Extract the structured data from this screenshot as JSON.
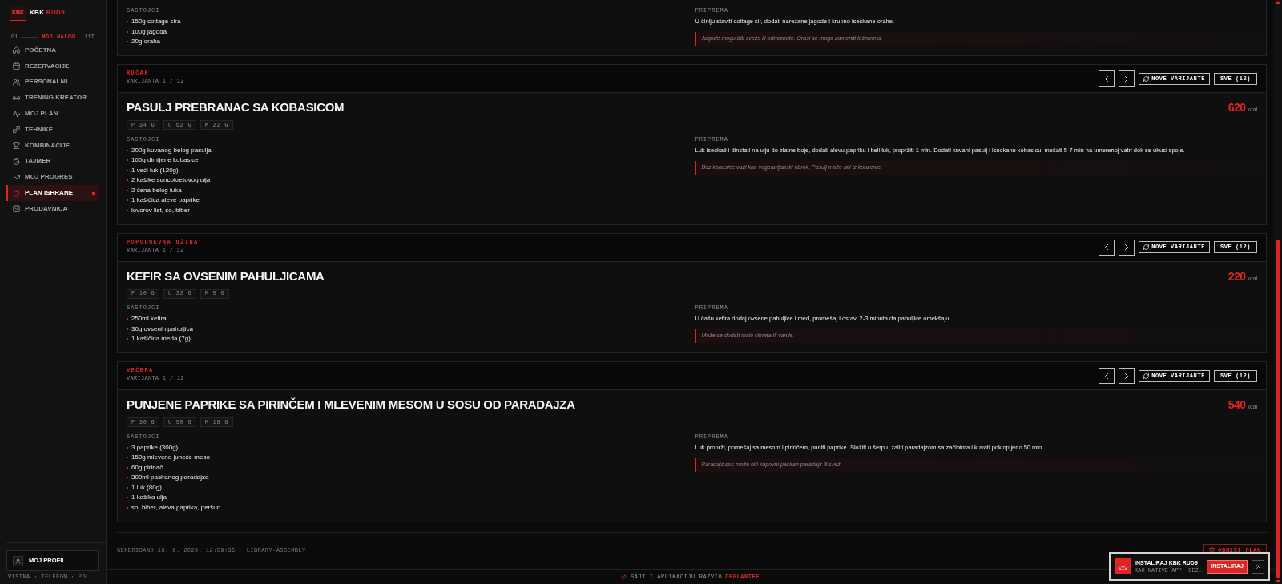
{
  "sidebar": {
    "logo": {
      "mark": "KBK",
      "title": "KBK",
      "accent": "RUD9"
    },
    "section": {
      "index": "01",
      "title": "MOJ NALOG",
      "count": "11T"
    },
    "items": [
      {
        "label": "POČETNA",
        "selected": false
      },
      {
        "label": "REZERVACIJE",
        "selected": false
      },
      {
        "label": "PERSONALNI",
        "selected": false
      },
      {
        "label": "TRENING KREATOR",
        "selected": false
      },
      {
        "label": "MOJ PLAN",
        "selected": false
      },
      {
        "label": "TEHNIKE",
        "selected": false
      },
      {
        "label": "KOMBINACIJE",
        "selected": false
      },
      {
        "label": "TAJMER",
        "selected": false
      },
      {
        "label": "MOJ PROGRES",
        "selected": false
      },
      {
        "label": "PLAN ISHRANE",
        "selected": true
      },
      {
        "label": "PRODAVNICA",
        "selected": false
      }
    ],
    "profile": {
      "label": "MOJ PROFIL",
      "hint": "VISINA · TELEFON · POL"
    }
  },
  "meals": [
    {
      "ingredients_label": "SASTOJCI",
      "ingredients": [
        "150g cottage sira",
        "100g jagoda",
        "20g oraha"
      ],
      "prep_label": "PRIPREMA",
      "prep": "U činiju staviti cottage sir, dodati narezane jagode i krupno iseckane orahe.",
      "note": "Jagode mogu biti sveže ili odmrznute. Orasi se mogu zameniti lešnicima."
    },
    {
      "type": "RUČAK",
      "variant": "VARIJANTA 1 / 12",
      "buttons": {
        "refresh": "NOVE VARIJANTE",
        "all": "SVE (12)"
      },
      "title": "PASULJ PREBRANAC SA KOBASICOM",
      "kcal": "620",
      "kcal_unit": "kcal",
      "macros": [
        "P 34 G",
        "U 62 G",
        "M 22 G"
      ],
      "ingredients_label": "SASTOJCI",
      "ingredients": [
        "200g kuvanog belog pasulja",
        "100g dimljene kobasice",
        "1 veći luk (120g)",
        "2 kašike suncokretovog ulja",
        "2 čena belog luka",
        "1 kašičica aleve paprike",
        "lovorov list, so, biber"
      ],
      "prep_label": "PRIPREMA",
      "prep": "Luk iseckati i dinstati na ulju do zlatne boje, dodati alevu papriku i beli luk, propržiti 1 min. Dodati kuvani pasulj i iseckanu kobasicu, mešati 5-7 min na umerenoj vatri dok se ukusi spoje.",
      "note": "Bez kobasice važi kao vegetarijanski obrok. Pasulj može biti iz konzerve."
    },
    {
      "type": "POPODNEVNA UŽINA",
      "variant": "VARIJANTA 1 / 12",
      "buttons": {
        "refresh": "NOVE VARIJANTE",
        "all": "SVE (12)"
      },
      "title": "KEFIR SA OVSENIM PAHULJICAMA",
      "kcal": "220",
      "kcal_unit": "kcal",
      "macros": [
        "P 10 G",
        "U 32 G",
        "M 5 G"
      ],
      "ingredients_label": "SASTOJCI",
      "ingredients": [
        "250ml kefira",
        "30g ovsenih pahuljica",
        "1 kašičica meda (7g)"
      ],
      "prep_label": "PRIPREMA",
      "prep": "U čašu kefira dodaj ovsene pahuljice i med, promešaj i ostavi 2-3 minuta da pahuljice omekšaju.",
      "note": "Može se dodati malo cimeta ili vanile."
    },
    {
      "type": "VEČERA",
      "variant": "VARIJANTA 1 / 12",
      "buttons": {
        "refresh": "NOVE VARIJANTE",
        "all": "SVE (12)"
      },
      "title": "PUNJENE PAPRIKE SA PIRINČEM I MLEVENIM MESOM U SOSU OD PARADAJZA",
      "kcal": "540",
      "kcal_unit": "kcal",
      "macros": [
        "P 30 G",
        "U 50 G",
        "M 18 G"
      ],
      "ingredients_label": "SASTOJCI",
      "ingredients": [
        "3 paprike (300g)",
        "150g mleveno juneće meso",
        "60g pirinač",
        "300ml pasiranog paradajza",
        "1 luk (80g)",
        "1 kašika ulja",
        "so, biber, aleva paprika, peršun"
      ],
      "prep_label": "PRIPREMA",
      "prep": "Luk proprži, pomešaj sa mesom i pirinčem, puniti paprike. Složiti u šerpu, zaliti paradajzom sa začinima i kuvati poklopljeno 50 min.",
      "note": "Paradajz sos može biti kupovni pasiran paradajz ili svež."
    }
  ],
  "footer": {
    "generated": "GENERISANO 16. 6. 2026. 12:59:35 · LIBRARY-ASSEMBLY",
    "delete_button": "OBRIŠI PLAN"
  },
  "credits": {
    "text": "SAJT I APLIKACIJU RAZVIO",
    "author": "DEGLANTEE"
  },
  "install_prompt": {
    "title": "INSTALIRAJ KBK RUD9",
    "subtitle": "KAO NATIVE APP, BEZ…",
    "button": "INSTALIRAJ"
  }
}
